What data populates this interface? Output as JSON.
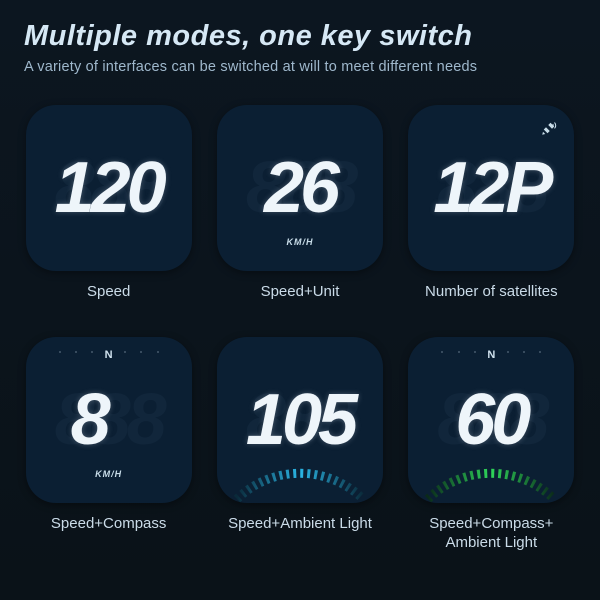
{
  "header": {
    "title": "Multiple modes, one key switch",
    "subtitle": "A variety of interfaces can be switched at will to meet different needs"
  },
  "tiles": [
    {
      "value": "120",
      "caption": "Speed",
      "unit": "",
      "compass": "",
      "satellite": false,
      "arc": ""
    },
    {
      "value": "26",
      "caption": "Speed+Unit",
      "unit": "KM/H",
      "compass": "",
      "satellite": false,
      "arc": ""
    },
    {
      "value": "12P",
      "caption": "Number of satellites",
      "unit": "",
      "compass": "",
      "satellite": true,
      "arc": ""
    },
    {
      "value": "8",
      "caption": "Speed+Compass",
      "unit": "KM/H",
      "compass": "N",
      "satellite": false,
      "arc": "",
      "leftAlign": true
    },
    {
      "value": "105",
      "caption": "Speed+Ambient Light",
      "unit": "",
      "compass": "",
      "satellite": false,
      "arc": "blue"
    },
    {
      "value": "60",
      "caption": "Speed+Compass+\nAmbient Light",
      "unit": "",
      "compass": "N",
      "satellite": false,
      "arc": "green"
    }
  ],
  "ghost": "888",
  "colors": {
    "arc_blue": "#2ab6e6",
    "arc_green": "#2fd65a"
  }
}
